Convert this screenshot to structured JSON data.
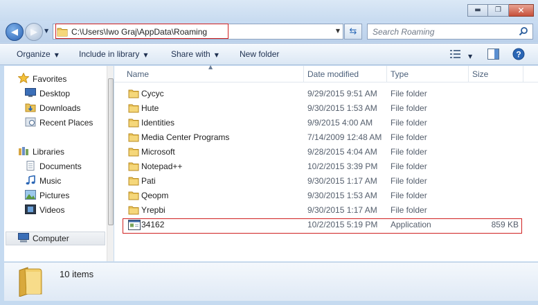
{
  "window": {
    "minimize_glyph": "▬",
    "maximize_glyph": "❐",
    "close_glyph": "✕"
  },
  "address": {
    "path": "C:\\Users\\Iwo Graj\\AppData\\Roaming",
    "highlight_color": "#d02020"
  },
  "search": {
    "placeholder": "Search Roaming"
  },
  "toolbar": {
    "organize": "Organize",
    "include_in_library": "Include in library",
    "share_with": "Share with",
    "new_folder": "New folder"
  },
  "nav": {
    "favorites": "Favorites",
    "desktop": "Desktop",
    "downloads": "Downloads",
    "recent_places": "Recent Places",
    "libraries": "Libraries",
    "documents": "Documents",
    "music": "Music",
    "pictures": "Pictures",
    "videos": "Videos",
    "computer": "Computer"
  },
  "columns": {
    "name": "Name",
    "date_modified": "Date modified",
    "type": "Type",
    "size": "Size"
  },
  "files": [
    {
      "name": "Cycyc",
      "date": "9/29/2015 9:51 AM",
      "type": "File folder",
      "size": "",
      "icon": "folder-icon"
    },
    {
      "name": "Hute",
      "date": "9/30/2015 1:53 AM",
      "type": "File folder",
      "size": "",
      "icon": "folder-icon"
    },
    {
      "name": "Identities",
      "date": "9/9/2015 4:00 AM",
      "type": "File folder",
      "size": "",
      "icon": "folder-icon"
    },
    {
      "name": "Media Center Programs",
      "date": "7/14/2009 12:48 AM",
      "type": "File folder",
      "size": "",
      "icon": "folder-icon"
    },
    {
      "name": "Microsoft",
      "date": "9/28/2015 4:04 AM",
      "type": "File folder",
      "size": "",
      "icon": "folder-icon"
    },
    {
      "name": "Notepad++",
      "date": "10/2/2015 3:39 PM",
      "type": "File folder",
      "size": "",
      "icon": "folder-icon"
    },
    {
      "name": "Pati",
      "date": "9/30/2015 1:17 AM",
      "type": "File folder",
      "size": "",
      "icon": "folder-icon"
    },
    {
      "name": "Qeopm",
      "date": "9/30/2015 1:53 AM",
      "type": "File folder",
      "size": "",
      "icon": "folder-icon"
    },
    {
      "name": "Yrepbi",
      "date": "9/30/2015 1:17 AM",
      "type": "File folder",
      "size": "",
      "icon": "folder-icon"
    },
    {
      "name": "34162",
      "date": "10/2/2015 5:19 PM",
      "type": "Application",
      "size": "859 KB",
      "icon": "application-icon"
    }
  ],
  "details": {
    "item_count": "10 items"
  }
}
